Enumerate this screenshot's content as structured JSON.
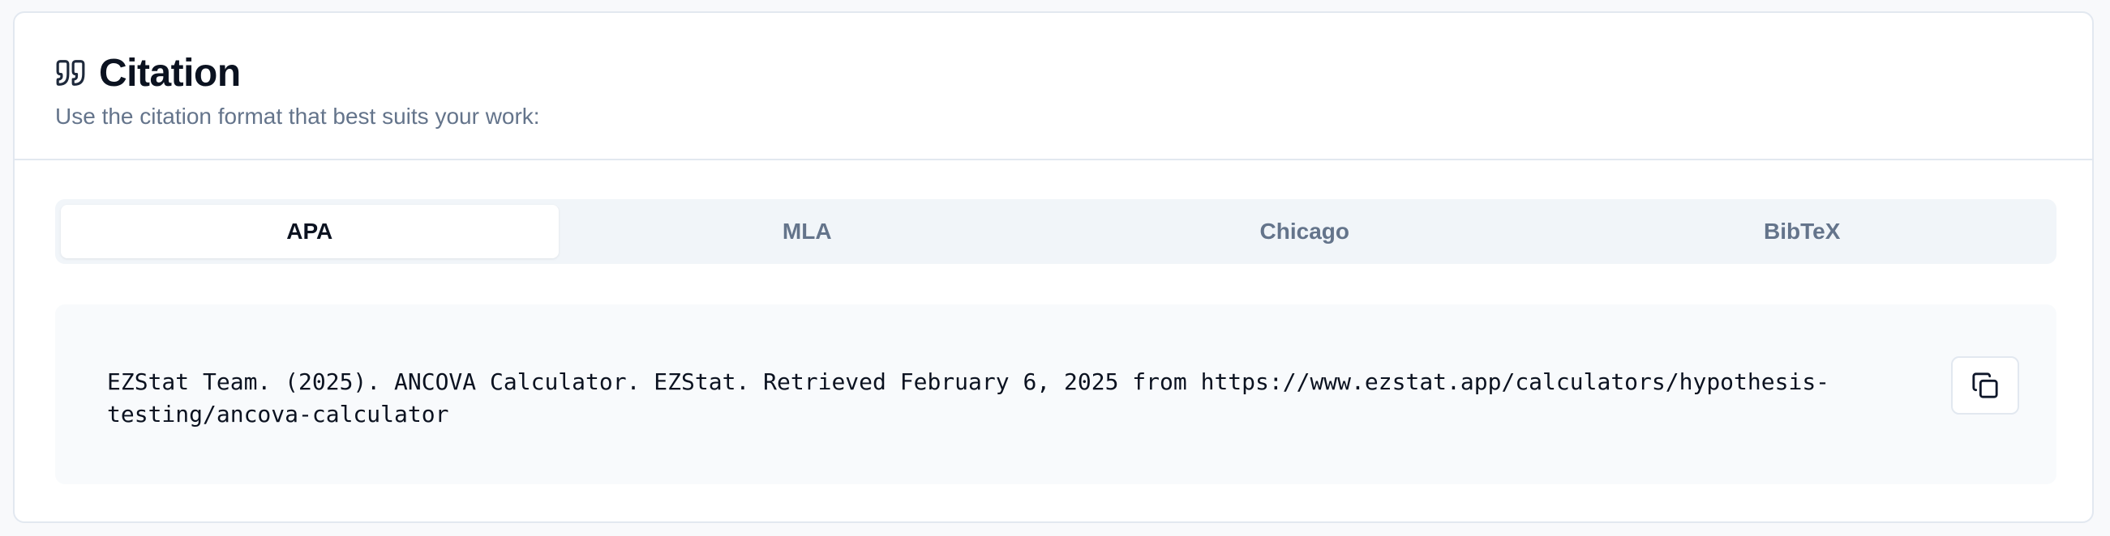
{
  "header": {
    "icon": "quote-icon",
    "title": "Citation",
    "subtitle": "Use the citation format that best suits your work:"
  },
  "tabs": [
    {
      "label": "APA",
      "active": true
    },
    {
      "label": "MLA",
      "active": false
    },
    {
      "label": "Chicago",
      "active": false
    },
    {
      "label": "BibTeX",
      "active": false
    }
  ],
  "citation": {
    "text": "EZStat Team. (2025). ANCOVA Calculator. EZStat. Retrieved February 6, 2025 from https://www.ezstat.app/calculators/hypothesis-testing/ancova-calculator",
    "copy_icon": "copy-icon"
  },
  "colors": {
    "page_background": "#f8f9fb",
    "card_border": "#e2e8f0",
    "tab_track": "#f1f5f9",
    "active_tab": "#ffffff",
    "muted_text": "#64748b",
    "primary_text": "#0b1220",
    "citation_background": "#f8fafc"
  }
}
